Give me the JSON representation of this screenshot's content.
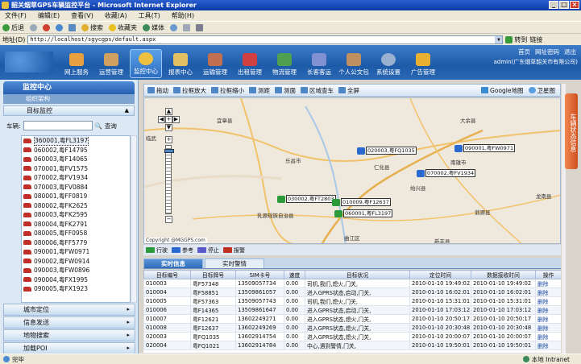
{
  "window": {
    "title": "韶关烟草GPS车辆监控平台 - Microsoft Internet Explorer"
  },
  "menu": [
    "文件(F)",
    "编辑(E)",
    "查看(V)",
    "收藏(A)",
    "工具(T)",
    "帮助(H)"
  ],
  "toolbar": {
    "back": "后退",
    "search": "搜索",
    "favorites": "收藏夹",
    "media": "媒体"
  },
  "address": {
    "label": "地址(D)",
    "url": "http://localhost/sgycgps/default.aspx",
    "go": "转到",
    "links": "链接"
  },
  "app": {
    "nav": [
      "网上服务",
      "运营管理",
      "监控中心",
      "报表中心",
      "运输管理",
      "出租管理",
      "物流管理",
      "长客客运",
      "个人公文包",
      "系统设置",
      "广告管理"
    ],
    "active_nav": 2,
    "top_links": [
      "首页",
      "网址密码",
      "退出"
    ],
    "welcome": "admin(广东烟草韶关市有限公司)"
  },
  "sidebar": {
    "title": "监控中心",
    "subtitle": "组织架构",
    "section": "目标监控",
    "search_label": "车辆:",
    "search_button": "查询",
    "vehicles": [
      "360001,粤FL3197",
      "060002,粤F14795",
      "060003,粤F14065",
      "070001,粤FV1575",
      "070002,粤FV1934",
      "070003,粤FV0884",
      "080001,粤FF0819",
      "080002,粤FK2625",
      "080003,粤FK2595",
      "080004,粤FK2791",
      "080005,粤FF0958",
      "080006,粤FF5779",
      "090001,粤FW0971",
      "090002,粤FW0914",
      "090003,粤FW0896",
      "090004,粤FX1995",
      "090005,粤FX1923"
    ],
    "selected_index": 0,
    "bottom_sections": [
      "城市定位",
      "信息发送",
      "地物搜索",
      "加载POI"
    ]
  },
  "map_toolbar": [
    "拖动",
    "拉框放大",
    "拉框缩小",
    "测距",
    "测面",
    "区域查车",
    "全屏"
  ],
  "map_toolbar_right": [
    "Google地图",
    "卫星图"
  ],
  "map": {
    "places": [
      "宜章县",
      "临武",
      "乐昌市",
      "仁化县",
      "始兴县",
      "南雄市",
      "大余县",
      "乳源瑶族自治县",
      "曲江区",
      "翁源县",
      "新丰县",
      "龙南县"
    ],
    "markers": [
      "020003,粤FQ1035",
      "090001,粤FW0971",
      "070002,粤FV1934",
      "030002,粤FT2803",
      "010009,粤F12637",
      "060001,粤FL3197"
    ],
    "copyright": "Copyright @MGGPS.com"
  },
  "side_tab": "车辆状态信息",
  "legend": [
    "行驶",
    "参考",
    "停止",
    "报警"
  ],
  "tabs": [
    "实时信息",
    "实时警情"
  ],
  "table": {
    "headers": [
      "目标编号",
      "目标牌号",
      "SIM卡号",
      "速度",
      "目标状况",
      "定位时间",
      "数据接收时间",
      "操作"
    ],
    "rows": [
      [
        "010003",
        "粤F57348",
        "13509057734",
        "0.00",
        "司机,我们,熄火,门关,",
        "2010-01-10 19:49:02",
        "2010-01-10 19:49:02",
        "删除"
      ],
      [
        "010004",
        "粤F58851",
        "13509861057",
        "0.00",
        "进入GPRS状态,启动,门关,",
        "2010-01-10 16:02:01",
        "2010-01-10 16:02:01",
        "删除"
      ],
      [
        "010005",
        "粤F57363",
        "13509057743",
        "0.00",
        "司机,我们,熄火,门关,",
        "2010-01-10 15:31:01",
        "2010-01-10 15:31:01",
        "删除"
      ],
      [
        "010006",
        "粤F14365",
        "13509861647",
        "0.00",
        "进入GPRS状态,启动,门关,",
        "2010-01-10 17:03:12",
        "2010-01-10 17:03:12",
        "删除"
      ],
      [
        "010007",
        "粤F12621",
        "13602249271",
        "0.00",
        "进入GPRS状态,熄火,门关,",
        "2010-01-10 20:50:17",
        "2010-01-10 20:50:17",
        "删除"
      ],
      [
        "010008",
        "粤F12637",
        "13602249269",
        "0.00",
        "进入GPRS状态,熄火,门关,",
        "2010-01-10 20:30:48",
        "2010-01-10 20:30:48",
        "删除"
      ],
      [
        "020003",
        "粤FQ1035",
        "13602914754",
        "0.00",
        "进入GPRS状态,熄火,门关,",
        "2010-01-10 20:00:07",
        "2010-01-10 20:00:07",
        "删除"
      ],
      [
        "020004",
        "粤FQ1021",
        "13602914784",
        "0.00",
        "中心,遇到警情,门关,",
        "2010-01-10 19:50:01",
        "2010-01-10 19:50:01",
        "删除"
      ]
    ]
  },
  "statusbar": {
    "done": "完毕",
    "zone": "本地 Intranet"
  },
  "colors": {
    "accent": "#1d5aa8",
    "running": "#2a9a3a",
    "reference": "#2a6ad0",
    "stopped": "#5a5ac8",
    "alarm": "#c03020"
  }
}
